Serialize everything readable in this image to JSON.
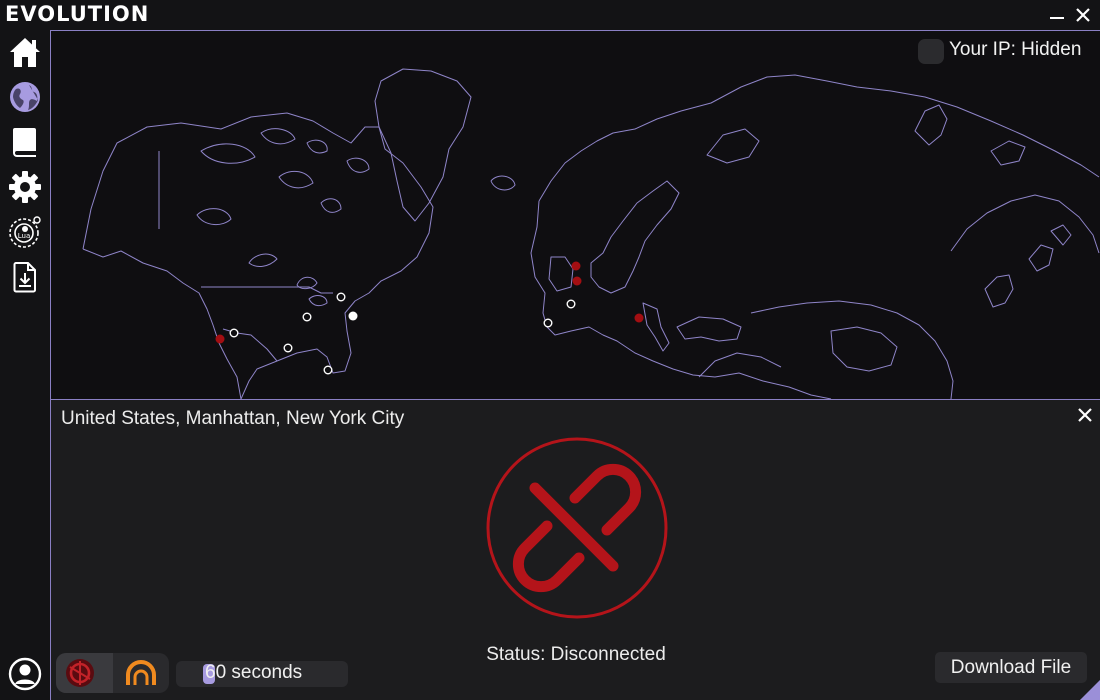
{
  "app": {
    "title": "EVOLUTION"
  },
  "window_controls": {
    "minimize": "—",
    "close": "✕"
  },
  "sidebar": {
    "items": [
      {
        "name": "home",
        "icon": "home-icon",
        "active": false
      },
      {
        "name": "globe",
        "icon": "globe-icon",
        "active": true
      },
      {
        "name": "book",
        "icon": "book-icon",
        "active": false
      },
      {
        "name": "settings",
        "icon": "gear-icon",
        "active": false
      },
      {
        "name": "lua",
        "icon": "lua-icon",
        "label": "Lua",
        "active": false
      },
      {
        "name": "file-download",
        "icon": "file-download-icon",
        "active": false
      }
    ],
    "footer_icon": "user-icon"
  },
  "map": {
    "ip_label": "Your IP: Hidden",
    "ip_toggle_on": false,
    "colors": {
      "outline": "#8f85c9",
      "server_available": "#ffffff",
      "server_unavailable": "#a30e12"
    }
  },
  "connection_panel": {
    "location": "United States, Manhattan, New York City",
    "close": "✕",
    "status": "Status: Disconnected",
    "status_color": "#b4141a",
    "timer_label": "60 seconds",
    "download_label": "Download File"
  },
  "accent_color": "#9b8fd8"
}
